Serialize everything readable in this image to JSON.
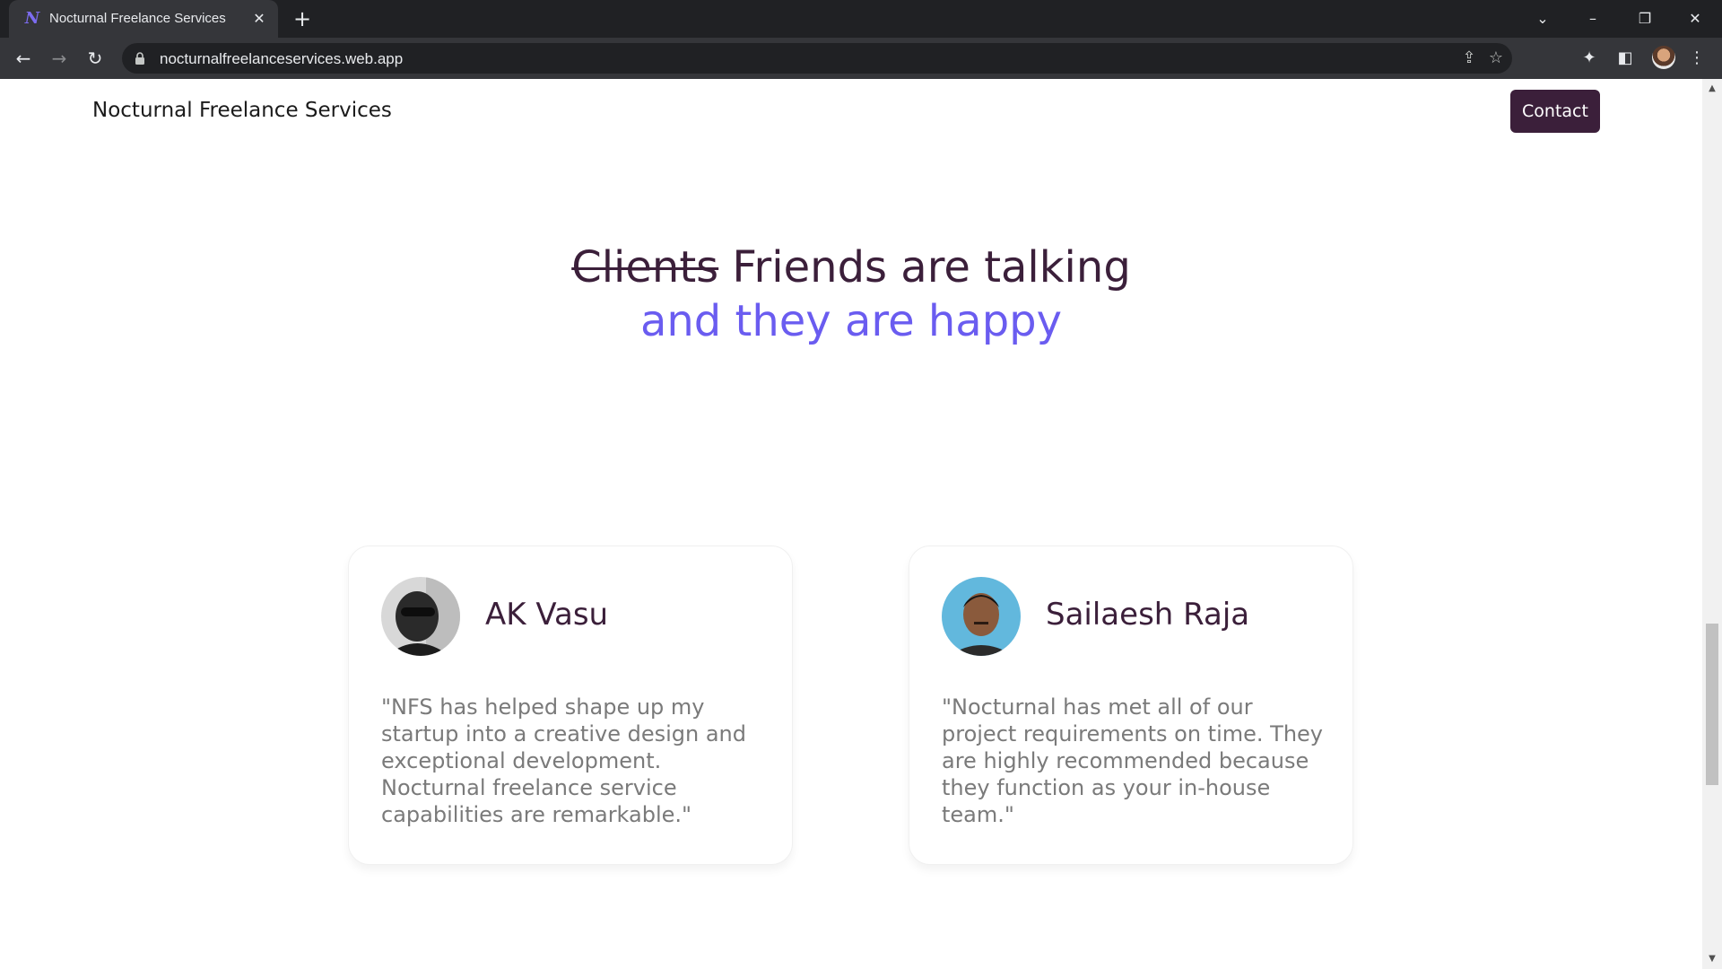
{
  "browser": {
    "tab_title": "Nocturnal Freelance Services",
    "tab_favicon_letter": "N",
    "url": "nocturnalfreelanceservices.web.app"
  },
  "page": {
    "brand": "Nocturnal Freelance Services",
    "contact_label": "Contact",
    "headline": {
      "struck_word": "Clients",
      "line1_rest": " Friends are talking",
      "line2": "and they are happy"
    },
    "testimonials": [
      {
        "name": "AK Vasu",
        "quote": "\"NFS has helped shape up my startup into a creative design and exceptional development. Nocturnal freelance service capabilities are remarkable.\""
      },
      {
        "name": "Sailaesh Raja",
        "quote": "\"Nocturnal has met all of our project requirements on time. They are highly recommended because they function as your in-house team.\""
      }
    ]
  },
  "colors": {
    "brand_dark": "#3b1f3a",
    "accent_purple": "#6a5cf0",
    "quote_gray": "#7a7a7a"
  }
}
